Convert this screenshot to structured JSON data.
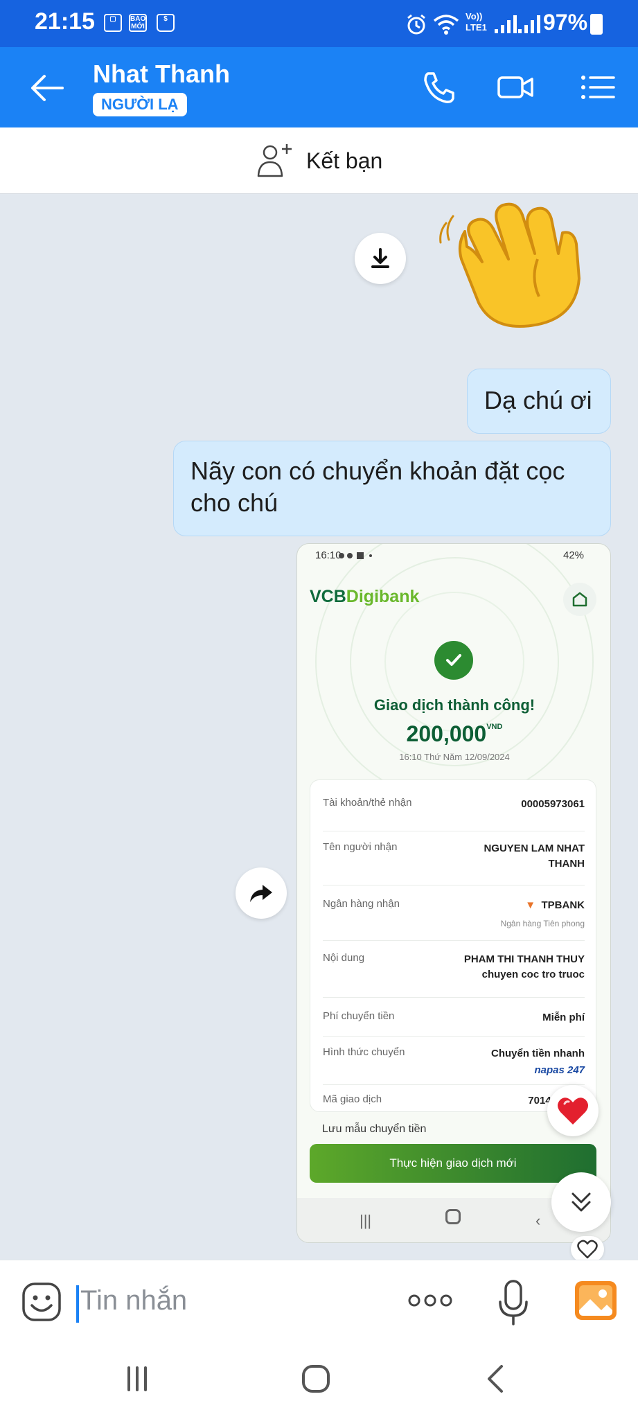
{
  "status_bar": {
    "time": "21:15",
    "bao_moi_label": "BÁO MỚI",
    "network_label": "Vo)) LTE1",
    "battery": "97%"
  },
  "header": {
    "contact_name": "Nhat Thanh",
    "badge": "NGƯỜI LẠ"
  },
  "add_friend": {
    "label": "Kết bạn"
  },
  "messages": [
    {
      "text": "Dạ chú ơi"
    },
    {
      "text": "Nãy con có chuyển khoản đặt cọc cho chú"
    }
  ],
  "receipt": {
    "status_time": "16:10",
    "status_battery": "42%",
    "logo_vcb": "VCB",
    "logo_digibank": "Digibank",
    "success_text": "Giao dịch thành công!",
    "amount": "200,000",
    "currency": "VND",
    "datetime": "16:10 Thứ Năm 12/09/2024",
    "rows": [
      {
        "label": "Tài khoản/thẻ nhận",
        "value": "00005973061"
      },
      {
        "label": "Tên người nhận",
        "value": "NGUYEN LAM NHAT THANH"
      },
      {
        "label": "Ngân hàng nhận",
        "value": "TPBANK",
        "sub": "Ngân hàng Tiên phong"
      },
      {
        "label": "Nội dung",
        "value": "PHAM THI THANH THUY chuyen coc tro truoc"
      },
      {
        "label": "Phí chuyển tiền",
        "value": "Miễn phí"
      },
      {
        "label": "Hình thức chuyển",
        "value": "Chuyển tiền nhanh",
        "sub": "napas 247"
      },
      {
        "label": "Mã giao dịch",
        "value": "70140"
      }
    ],
    "save_template": "Lưu mẫu chuyển tiền",
    "new_transaction": "Thực hiện giao dịch mới"
  },
  "input": {
    "placeholder": "Tin nhắn"
  },
  "colors": {
    "header": "#1b82f5",
    "statusbar": "#1663e0",
    "bubble": "#d4ebfd",
    "chat_bg": "#e2e8ef"
  }
}
